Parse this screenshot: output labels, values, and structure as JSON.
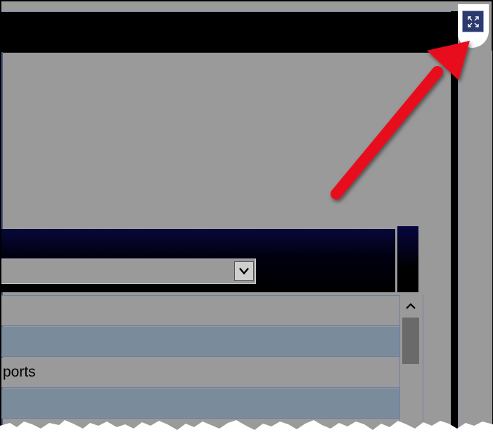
{
  "window": {
    "expand_button": {
      "icon": "expand-icon",
      "tooltip": ""
    }
  },
  "dropdown": {
    "selected_value": "",
    "icon": "chevron-down-icon"
  },
  "list": {
    "rows": [
      {
        "label": ""
      },
      {
        "label": ""
      },
      {
        "label": "ports"
      },
      {
        "label": ""
      }
    ]
  },
  "scrollbar": {
    "up_icon": "chevron-up-icon"
  },
  "annotation": {
    "arrow_color": "#e8101a",
    "target": "expand-button"
  },
  "colors": {
    "background": "#9a9a9a",
    "header": "#000000",
    "row_alt": "#7a8b9b",
    "expand_button": "#2c3a6d"
  }
}
